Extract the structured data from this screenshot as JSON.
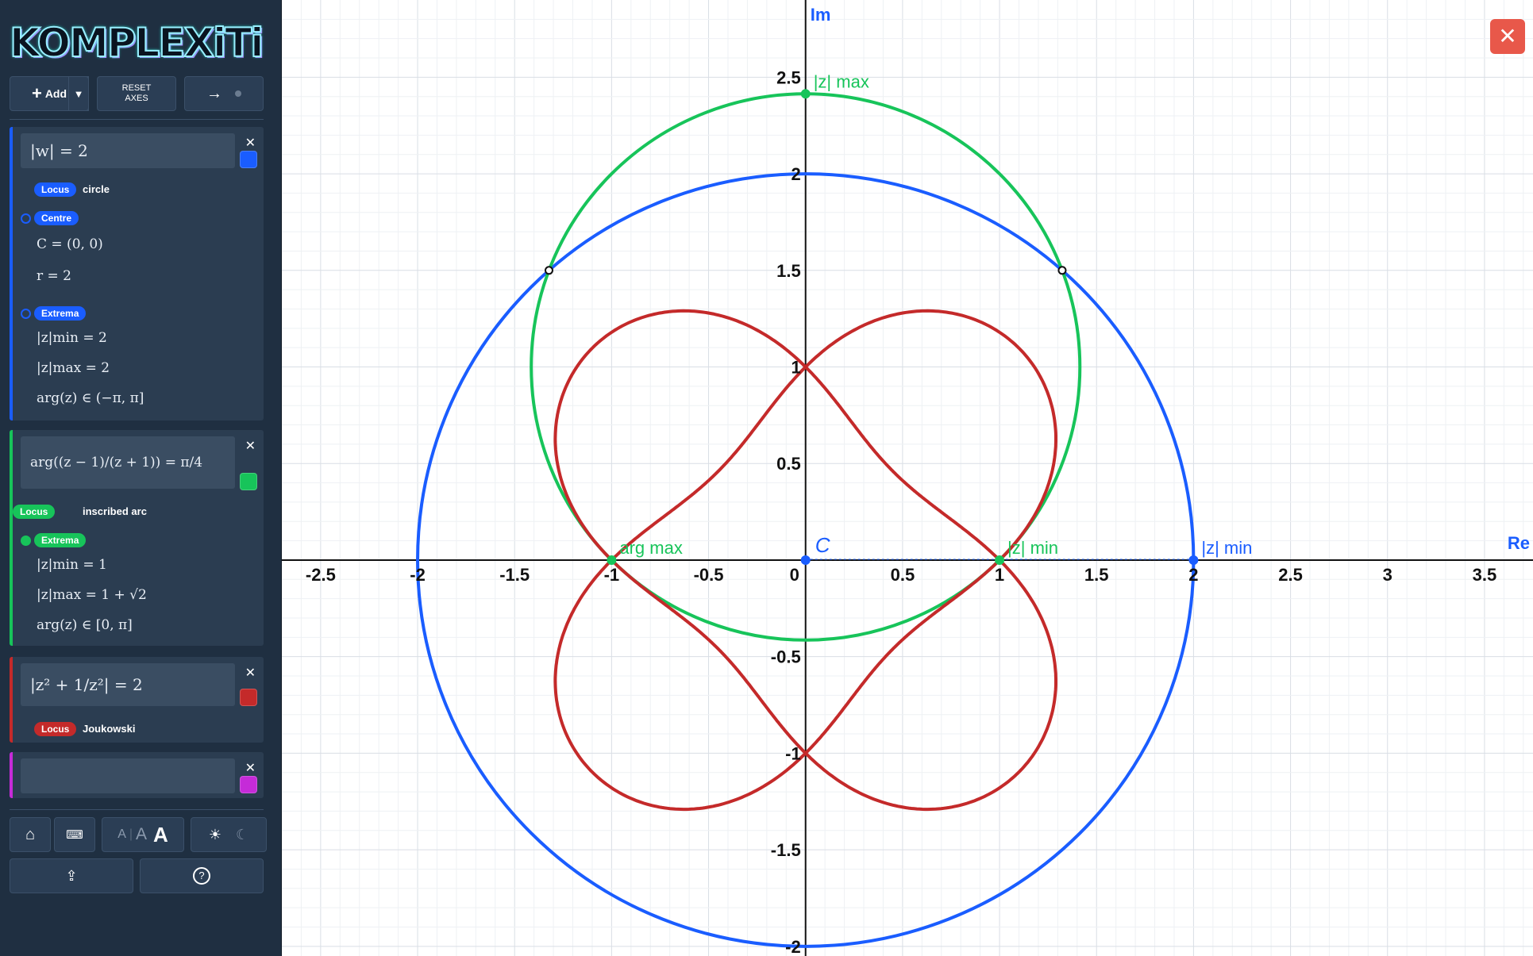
{
  "app": {
    "logo_text": "KOMPLEXiTi",
    "toolbar": {
      "add_label": "Add",
      "reset_label": "RESET AXES"
    }
  },
  "expressions": [
    {
      "latex_display": "|w| = 2",
      "color": "#1a5dff",
      "locus_badge": "Locus",
      "locus_type": "circle",
      "centre_badge": "Centre",
      "centre_value": "C = (0, 0)",
      "radius_value": "r = 2",
      "extrema_badge": "Extrema",
      "extrema": [
        "|z|min = 2",
        "|z|max = 2",
        "arg(z) ∈ (−π, π]"
      ]
    },
    {
      "latex_display": "arg((z − 1)/(z + 1)) = π/4",
      "color": "#17c45a",
      "locus_badge": "Locus",
      "locus_type": "inscribed arc",
      "extrema_badge": "Extrema",
      "extrema": [
        "|z|min = 1",
        "|z|max = 1 + √2",
        "arg(z) ∈ [0, π]"
      ]
    },
    {
      "latex_display": "|z² + 1/z²| = 2",
      "color": "#c42a2a",
      "locus_badge": "Locus",
      "locus_type": "Joukowski"
    },
    {
      "latex_display": "",
      "color": "#c52bd8"
    }
  ],
  "plot": {
    "axis_labels": {
      "x": "Re",
      "y": "Im"
    },
    "x_ticks": [
      "-2.5",
      "-2",
      "-1.5",
      "-1",
      "-0.5",
      "0",
      "0.5",
      "1",
      "1.5",
      "2",
      "2.5",
      "3",
      "3.5"
    ],
    "y_ticks": [
      "2.5",
      "2",
      "1.5",
      "1",
      "0.5",
      "-0.5",
      "-1",
      "-1.5",
      "-2"
    ],
    "annotations": {
      "green_max": "|z| max",
      "green_min": "|z| min",
      "arg_max": "arg max",
      "blue_min": "|z| min",
      "centre": "C"
    },
    "colors": {
      "blue": "#1a5dff",
      "green": "#17c45a",
      "red": "#c42a2a",
      "grid": "#e3e7ec",
      "axis": "#111111"
    }
  },
  "chart_data": {
    "type": "scatter",
    "title": "",
    "xlabel": "Re",
    "ylabel": "Im",
    "xlim": [
      -2.7,
      3.75
    ],
    "ylim": [
      -2.05,
      2.9
    ],
    "series": [
      {
        "name": "circle",
        "center": [
          0,
          0
        ],
        "radius": 2
      },
      {
        "name": "inscribed arc",
        "center": [
          0,
          1
        ],
        "radius": 1.4142
      },
      {
        "name": "Joukowski"
      }
    ],
    "points": [
      {
        "label": "|z| max",
        "x": 0,
        "y": 2.414
      },
      {
        "label": "|z| min",
        "x": 1,
        "y": 0
      },
      {
        "label": "arg max",
        "x": -1,
        "y": 0
      },
      {
        "label": "|z| min",
        "x": 2,
        "y": 0
      },
      {
        "label": "C",
        "x": 0,
        "y": 0
      }
    ],
    "grid": true
  }
}
